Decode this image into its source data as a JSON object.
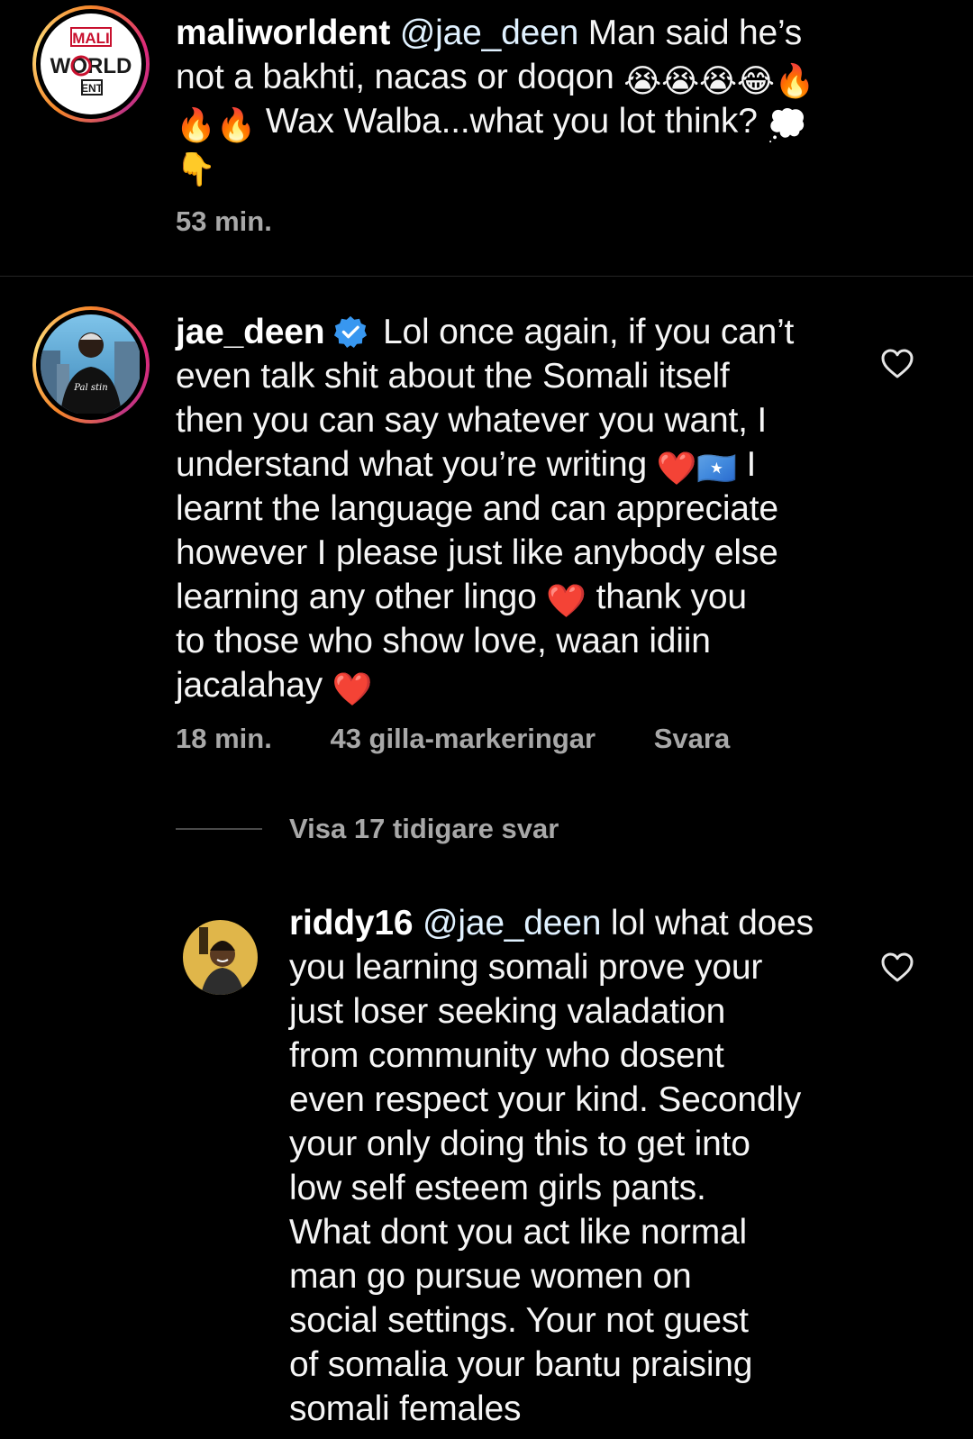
{
  "caption": {
    "username": "maliworldent",
    "mention": "@jae_deen",
    "text_line1": " Man said he’s",
    "text_line2": "not a bakhti, nacas or doqon",
    "text_line3": "Wax Walba...what you lot think?",
    "emojis_line2": [
      "😭",
      "😭",
      "😭",
      "😂",
      "🔥"
    ],
    "emojis_line3_lead": [
      "🔥",
      "🔥"
    ],
    "emoji_line3_tail": "💭",
    "emoji_line4": "👇",
    "time": "53 min.",
    "logo_text": {
      "top": "MALI",
      "mid": "WORLD",
      "bottom": "ENT"
    }
  },
  "comment": {
    "username": "jae_deen",
    "verified": true,
    "lines": [
      "Lol once again, if you can’t",
      "even talk shit about the Somali itself",
      "then you can say whatever you want, I",
      "understand what you’re writing",
      "learnt the language and can appreciate",
      "however I please just like anybody else",
      "learning any other lingo",
      "to those who show love, waan idiin",
      "jacalahay"
    ],
    "line4_tail": "I",
    "line7_tail": "thank you",
    "heart_emoji": "❤️",
    "flag_emoji": "🇸🇴",
    "time": "18 min.",
    "likes": "43 gilla-markeringar",
    "reply": "Svara"
  },
  "view_replies": {
    "label": "Visa 17 tidigare svar"
  },
  "reply": {
    "username": "riddy16",
    "mention": "@jae_deen",
    "lines": [
      " lol what does",
      "you learning somali prove your",
      "just loser seeking valadation",
      "from community who dosent",
      "even respect your kind. Secondly",
      "your only doing this to get into",
      "low self esteem girls pants.",
      "What dont you act like normal",
      "man go pursue women on",
      "social settings. Your not guest",
      "of somalia your bantu praising",
      "somali females"
    ]
  },
  "colors": {
    "background": "#000000",
    "text": "#f5f5f5",
    "meta": "#a8a8a8",
    "mention": "#e0f1ff",
    "verified": "#3897f0",
    "heart_emoji": "#ed1c24"
  },
  "icons": [
    "like-heart-icon",
    "verified-badge-icon"
  ]
}
